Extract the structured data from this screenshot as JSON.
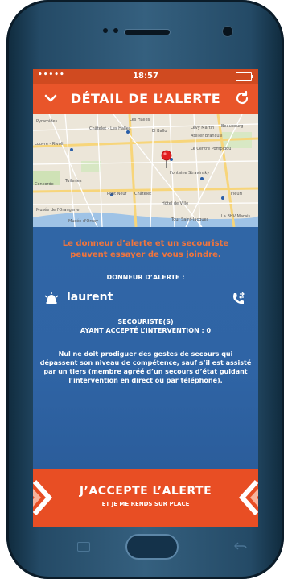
{
  "status_bar": {
    "signal": "•••••",
    "time": "18:57"
  },
  "app_bar": {
    "title": "DÉTAIL DE L’ALERTE",
    "back_icon": "chevron-down-icon",
    "refresh_icon": "refresh-icon"
  },
  "map": {
    "labels": [
      "Pyramides",
      "Les Halles",
      "Châtelet - Les Halles",
      "El Ballo",
      "Louvre - Rivoli",
      "Lévy Martin",
      "Atelier Brancusi",
      "Beaubourg",
      "Le Centre Pompidou",
      "Concorde",
      "Fontaine Stravinsky",
      "Tuileries",
      "Pont Neuf",
      "Châtelet",
      "Hôtel de Ville",
      "Fleuri",
      "La BHV Marais",
      "Tour Saint-Jacques",
      "Musée d'Orsay",
      "Musée de l'Orangerie"
    ]
  },
  "content": {
    "warning": "Le donneur d’alerte et un secouriste peuvent essayer de vous joindre.",
    "donneur_label": "DONNEUR D’ALERTE :",
    "donneur_name": "laurent",
    "secouristes_line1": "SECOURISTE(S)",
    "secouristes_line2": "AYANT ACCEPTÉ L’INTERVENTION : 0",
    "notice": "Nul ne doit prodiguer des gestes de secours qui dépassent son niveau de compétence, sauf s’il est assisté par un tiers (membre agréé d’un secours d’état guidant l’intervention en direct ou par téléphone)."
  },
  "cta": {
    "main": "J’ACCEPTE L’ALERTE",
    "sub": "ET JE ME RENDS SUR PLACE"
  },
  "colors": {
    "accent": "#e84e24",
    "content_bg": "#2f64a5",
    "warning_text": "#f0753d"
  }
}
